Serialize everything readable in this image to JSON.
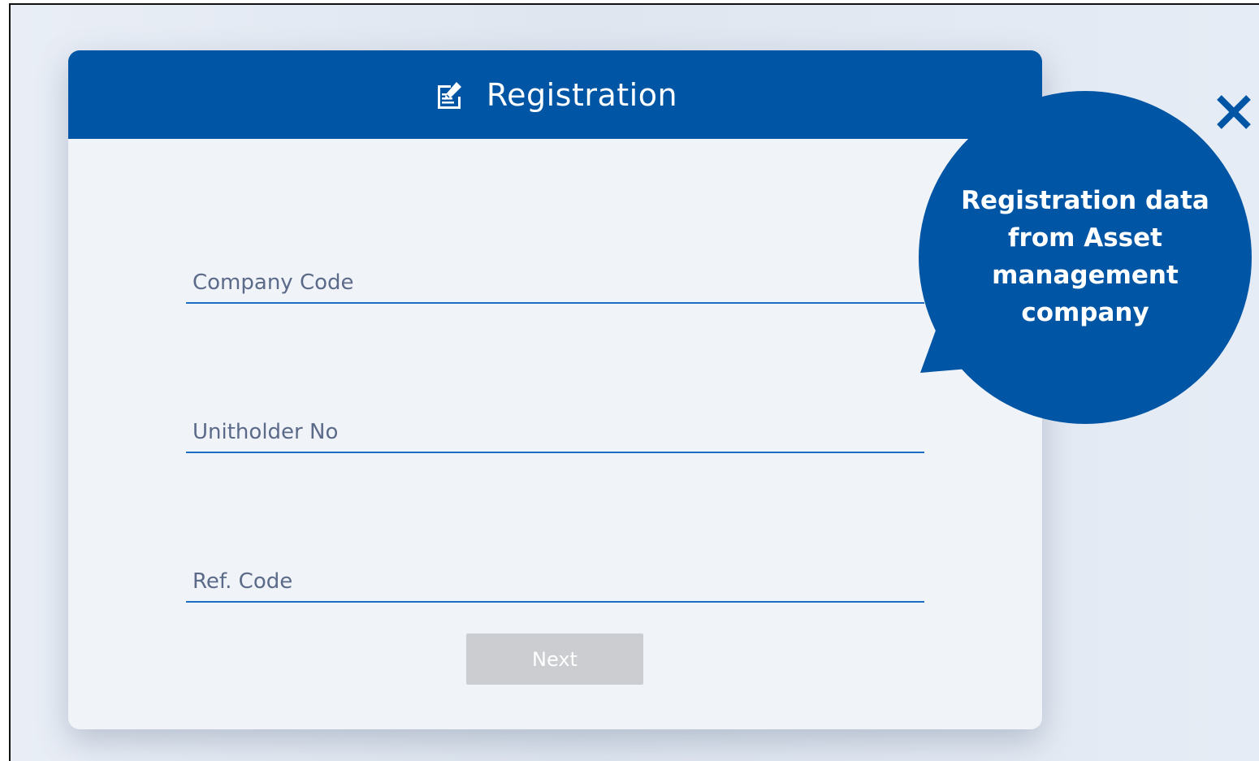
{
  "dialog": {
    "title": "Registration",
    "title_icon": "edit-document-icon",
    "accent_color": "#0055a5"
  },
  "form": {
    "company_code": {
      "placeholder": "Company Code",
      "value": ""
    },
    "unitholder_no": {
      "placeholder": "Unitholder No",
      "value": ""
    },
    "ref_code": {
      "placeholder": "Ref. Code",
      "value": ""
    },
    "next_label": "Next",
    "next_disabled_color": "#cbcdd0"
  },
  "tooltip": {
    "text": "Registration data from Asset management company",
    "color": "#0055a5"
  },
  "close": {
    "icon": "close-icon",
    "color": "#0055a5"
  }
}
